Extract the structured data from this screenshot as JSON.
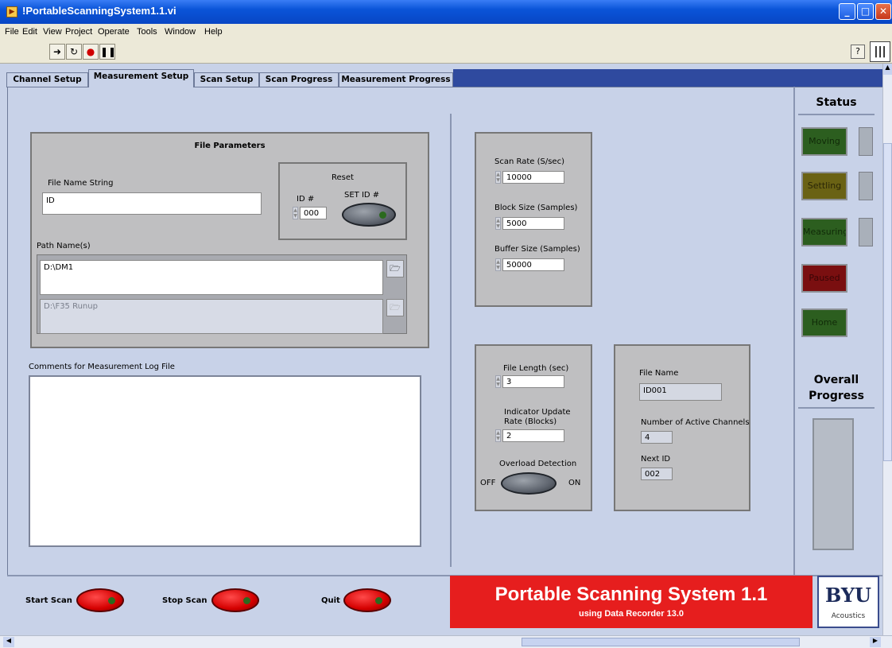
{
  "window": {
    "title": "!PortableScanningSystem1.1.vi"
  },
  "menu": {
    "items": [
      "File",
      "Edit",
      "View",
      "Project",
      "Operate",
      "Tools",
      "Window",
      "Help"
    ]
  },
  "tabs": [
    "Channel Setup",
    "Measurement Setup",
    "Scan Setup",
    "Scan Progress",
    "Measurement Progress"
  ],
  "file_params": {
    "title": "File Parameters",
    "file_name_label": "File Name String",
    "file_name_value": "ID",
    "reset_title": "Reset",
    "id_label": "ID #",
    "id_value": "000",
    "set_id_label": "SET ID #",
    "path_label": "Path Name(s)",
    "path1": "D:\\DM1",
    "path2": "D:\\F35 Runup"
  },
  "comments": {
    "label": "Comments for Measurement Log File",
    "value": ""
  },
  "scan": {
    "rate_label": "Scan Rate (S/sec)",
    "rate_value": "10000",
    "block_label": "Block Size (Samples)",
    "block_value": "5000",
    "buffer_label": "Buffer Size (Samples)",
    "buffer_value": "50000"
  },
  "file_len": {
    "label": "File Length (sec)",
    "value": "3",
    "indicator_label_1": "Indicator Update",
    "indicator_label_2": "Rate (Blocks)",
    "indicator_value": "2",
    "overload_label": "Overload Detection",
    "off": "OFF",
    "on": "ON"
  },
  "file_info": {
    "name_label": "File Name",
    "name_value": "ID001",
    "active_label": "Number of Active Channels",
    "active_value": "4",
    "next_label": "Next ID",
    "next_value": "002"
  },
  "status": {
    "title": "Status",
    "leds": [
      {
        "label": "Moving",
        "color": "#2c5e1f"
      },
      {
        "label": "Settling",
        "color": "#6a6214"
      },
      {
        "label": "Measuring",
        "color": "#2c5e1f"
      },
      {
        "label": "Paused",
        "color": "#7a0f10"
      },
      {
        "label": "Home",
        "color": "#2c5e1f"
      }
    ],
    "progress_title_1": "Overall",
    "progress_title_2": "Progress"
  },
  "buttons": {
    "start": "Start Scan",
    "stop": "Stop Scan",
    "quit": "Quit"
  },
  "banner": {
    "title": "Portable Scanning System 1.1",
    "subtitle": "using Data Recorder 13.0"
  },
  "logo": {
    "text": "BYU",
    "sub": "Acoustics"
  }
}
